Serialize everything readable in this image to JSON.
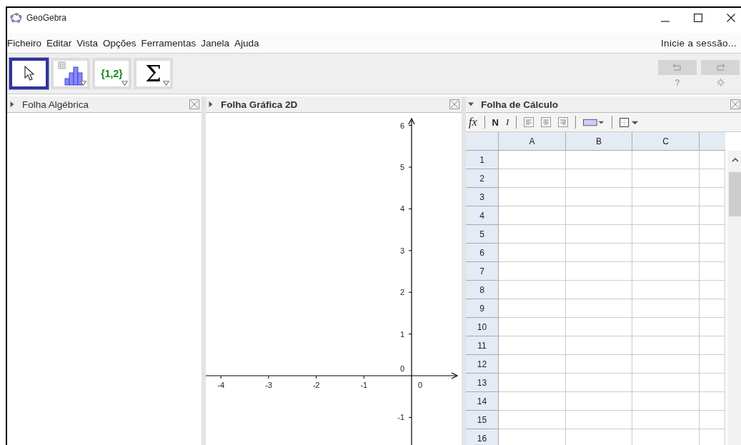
{
  "window": {
    "title": "GeoGebra"
  },
  "menu": [
    "Ficheiro",
    "Editar",
    "Vista",
    "Opções",
    "Ferramentas",
    "Janela",
    "Ajuda"
  ],
  "sign_in": "Inicie a sessão...",
  "tools": [
    {
      "kind": "pointer",
      "selected": true
    },
    {
      "kind": "chart",
      "selected": false
    },
    {
      "kind": "list",
      "label": "{1,2}",
      "selected": false
    },
    {
      "kind": "sum",
      "label": "Σ",
      "selected": false
    }
  ],
  "undo_redo": {
    "disabled": true
  },
  "help": "?",
  "panels": [
    {
      "kind": "algebra",
      "title": "Folha Algébrica",
      "expanded": false,
      "highlighted": false
    },
    {
      "kind": "graphics",
      "title": "Folha Gráfica 2D",
      "expanded": false,
      "highlighted": true
    },
    {
      "kind": "spreadsheet",
      "title": "Folha de Cálculo",
      "expanded": true,
      "highlighted": true
    }
  ],
  "graphics": {
    "x_ticks": [
      "-4",
      "-3",
      "-2",
      "-1",
      "0"
    ],
    "y_ticks": [
      "6",
      "5",
      "4",
      "3",
      "2",
      "1",
      "0",
      "-1"
    ]
  },
  "spreadsheet": {
    "toolbar": {
      "formula": "fx",
      "bold": "N",
      "italic": "I"
    },
    "columns": [
      "A",
      "B",
      "C"
    ],
    "rows": [
      "1",
      "2",
      "3",
      "4",
      "5",
      "6",
      "7",
      "8",
      "9",
      "10",
      "11",
      "12",
      "13",
      "14",
      "15",
      "16"
    ]
  }
}
